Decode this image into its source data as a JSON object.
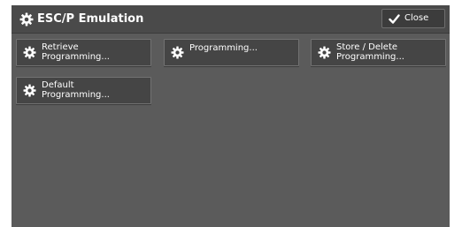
{
  "window": {
    "title": "ESC/P Emulation",
    "title_icon": "gear-icon"
  },
  "toolbar": {
    "close_label": "Close",
    "close_icon": "checkmark-icon"
  },
  "buttons": [
    {
      "line1": "Retrieve",
      "line2": "Programming...",
      "icon": "gear-icon"
    },
    {
      "line1": "Programming...",
      "line2": "",
      "icon": "gear-icon"
    },
    {
      "line1": "Store / Delete",
      "line2": "Programming...",
      "icon": "gear-icon"
    },
    {
      "line1": "Default",
      "line2": "Programming...",
      "icon": "gear-icon"
    }
  ],
  "colors": {
    "panel_background": "#5b5b5b",
    "titlebar_background": "#4a4a4a",
    "button_background": "#454545",
    "text": "#ffffff"
  }
}
